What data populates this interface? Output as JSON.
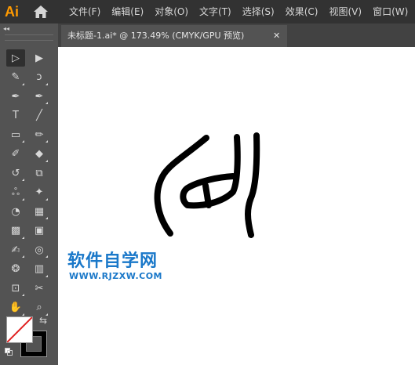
{
  "app": {
    "logo_text": "Ai"
  },
  "menu": [
    {
      "label": "文件(F)"
    },
    {
      "label": "编辑(E)"
    },
    {
      "label": "对象(O)"
    },
    {
      "label": "文字(T)"
    },
    {
      "label": "选择(S)"
    },
    {
      "label": "效果(C)"
    },
    {
      "label": "视图(V)"
    },
    {
      "label": "窗口(W)"
    }
  ],
  "toolbar": {
    "collapse_glyph": "◂◂",
    "tools": [
      {
        "name": "selection-tool-icon",
        "glyph": "▷",
        "active": true
      },
      {
        "name": "direct-selection-tool-icon",
        "glyph": "▶"
      },
      {
        "name": "magic-wand-tool-icon",
        "glyph": "✎"
      },
      {
        "name": "lasso-tool-icon",
        "glyph": "ↄ"
      },
      {
        "name": "pen-tool-icon",
        "glyph": "✒"
      },
      {
        "name": "curvature-tool-icon",
        "glyph": "✒"
      },
      {
        "name": "type-tool-icon",
        "glyph": "T"
      },
      {
        "name": "line-segment-tool-icon",
        "glyph": "╱"
      },
      {
        "name": "rectangle-tool-icon",
        "glyph": "▭"
      },
      {
        "name": "paintbrush-tool-icon",
        "glyph": "✏"
      },
      {
        "name": "shaper-tool-icon",
        "glyph": "✐"
      },
      {
        "name": "eraser-tool-icon",
        "glyph": "◆"
      },
      {
        "name": "rotate-tool-icon",
        "glyph": "↺"
      },
      {
        "name": "scale-tool-icon",
        "glyph": "⧉"
      },
      {
        "name": "warp-tool-icon",
        "glyph": "ஃ"
      },
      {
        "name": "puppet-warp-tool-icon",
        "glyph": "✦"
      },
      {
        "name": "shape-builder-tool-icon",
        "glyph": "◔"
      },
      {
        "name": "perspective-grid-tool-icon",
        "glyph": "▦"
      },
      {
        "name": "mesh-tool-icon",
        "glyph": "▩"
      },
      {
        "name": "gradient-tool-icon",
        "glyph": "▣"
      },
      {
        "name": "eyedropper-tool-icon",
        "glyph": "✍"
      },
      {
        "name": "blend-tool-icon",
        "glyph": "◎"
      },
      {
        "name": "symbol-sprayer-tool-icon",
        "glyph": "❂"
      },
      {
        "name": "column-graph-tool-icon",
        "glyph": "▥"
      },
      {
        "name": "artboard-tool-icon",
        "glyph": "⊡"
      },
      {
        "name": "slice-tool-icon",
        "glyph": "✂"
      },
      {
        "name": "hand-tool-icon",
        "glyph": "✋"
      },
      {
        "name": "zoom-tool-icon",
        "glyph": "⌕"
      }
    ],
    "swap_glyph": "⇆"
  },
  "document": {
    "tab_title": "未标题-1.ai* @ 173.49% (CMYK/GPU 预览)",
    "close_glyph": "✕"
  },
  "watermark": {
    "title": "软件自学网",
    "url": "WWW.RJZXW.COM",
    "color": "#1a78c9"
  }
}
